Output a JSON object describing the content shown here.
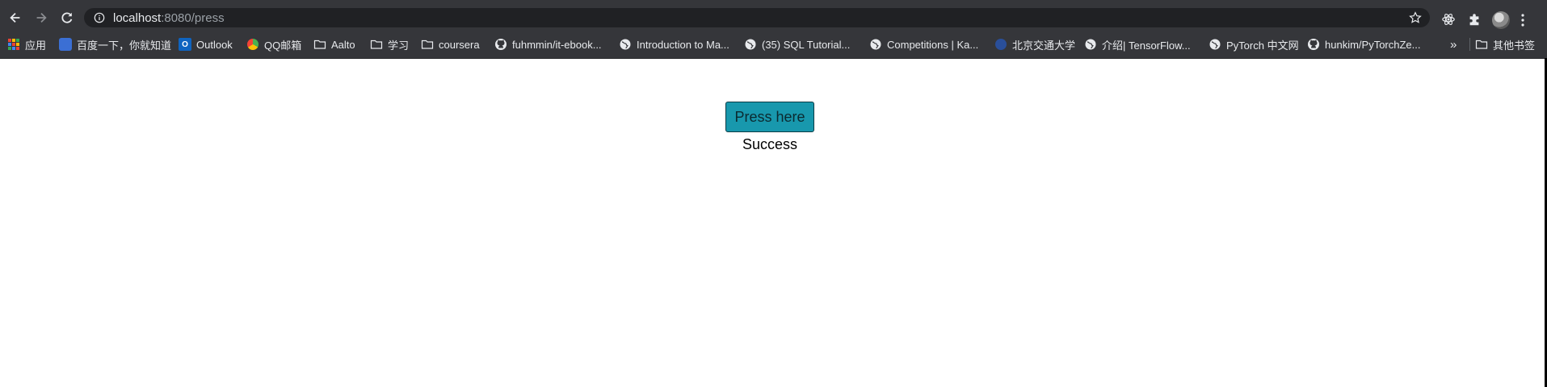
{
  "browser": {
    "url_host": "localhost",
    "url_rest": ":8080/press"
  },
  "bookmarks": [
    {
      "label": "应用",
      "icon": "apps-grid-icon"
    },
    {
      "label": "百度一下，你就知道",
      "icon": "baidu-icon"
    },
    {
      "label": "Outlook",
      "icon": "outlook-icon"
    },
    {
      "label": "QQ邮箱",
      "icon": "qq-mail-icon"
    },
    {
      "label": "Aalto",
      "icon": "folder-icon"
    },
    {
      "label": "学习",
      "icon": "folder-icon"
    },
    {
      "label": "coursera",
      "icon": "folder-icon"
    },
    {
      "label": "fuhmmin/it-ebook...",
      "icon": "github-icon"
    },
    {
      "label": "Introduction to Ma...",
      "icon": "globe-icon"
    },
    {
      "label": "(35) SQL Tutorial...",
      "icon": "globe-icon"
    },
    {
      "label": "Competitions | Ka...",
      "icon": "globe-icon"
    },
    {
      "label": "北京交通大学",
      "icon": "bjtu-icon"
    },
    {
      "label": "介绍| TensorFlow...",
      "icon": "globe-icon"
    },
    {
      "label": "PyTorch 中文网",
      "icon": "globe-icon"
    },
    {
      "label": "hunkim/PyTorchZe...",
      "icon": "github-icon"
    }
  ],
  "bookmarks_overflow": "»",
  "other_bookmarks": "其他书签",
  "page": {
    "button_label": "Press here",
    "result_text": "Success"
  },
  "colors": {
    "button_bg": "#1898ad",
    "chrome_bg": "#35363a",
    "omnibox_bg": "#202124"
  }
}
